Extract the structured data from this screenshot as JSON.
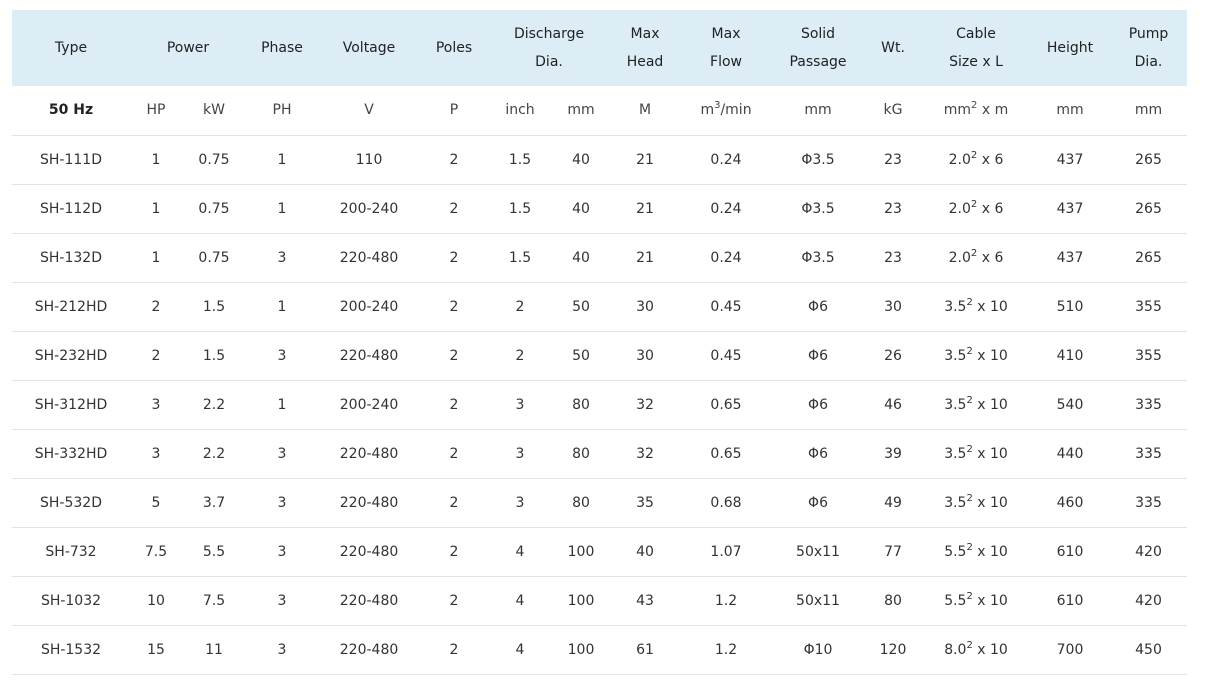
{
  "headers": {
    "type": "Type",
    "power": "Power",
    "phase": "Phase",
    "voltage": "Voltage",
    "poles": "Poles",
    "discharge": [
      "Discharge",
      "Dia."
    ],
    "max_head": [
      "Max",
      "Head"
    ],
    "max_flow": [
      "Max",
      "Flow"
    ],
    "solid_passage": [
      "Solid",
      "Passage"
    ],
    "weight": "Wt.",
    "cable": [
      "Cable",
      "Size x L"
    ],
    "height": "Height",
    "pump_dia": [
      "Pump",
      "Dia."
    ]
  },
  "units": {
    "freq": "50 Hz",
    "hp": "HP",
    "kw": "kW",
    "phase": "PH",
    "voltage": "V",
    "poles": "P",
    "inch": "inch",
    "mm": "mm",
    "head": "M",
    "flow_base": "m",
    "flow_sup": "3",
    "flow_rest": "/min",
    "solid": "mm",
    "weight": "kG",
    "cable_base": "mm",
    "cable_sup": "2",
    "cable_rest": " x m",
    "height": "mm",
    "pump_dia": "mm"
  },
  "rows": [
    {
      "type": "SH-111D",
      "hp": "1",
      "kw": "0.75",
      "phase": "1",
      "voltage": "110",
      "poles": "2",
      "inch": "1.5",
      "mm": "40",
      "head": "21",
      "flow": "0.24",
      "solid": "Φ3.5",
      "weight": "23",
      "cable_base": "2.0",
      "cable_sup": "2",
      "cable_rest": " x 6",
      "height": "437",
      "pump_dia": "265"
    },
    {
      "type": "SH-112D",
      "hp": "1",
      "kw": "0.75",
      "phase": "1",
      "voltage": "200-240",
      "poles": "2",
      "inch": "1.5",
      "mm": "40",
      "head": "21",
      "flow": "0.24",
      "solid": "Φ3.5",
      "weight": "23",
      "cable_base": "2.0",
      "cable_sup": "2",
      "cable_rest": " x 6",
      "height": "437",
      "pump_dia": "265"
    },
    {
      "type": "SH-132D",
      "hp": "1",
      "kw": "0.75",
      "phase": "3",
      "voltage": "220-480",
      "poles": "2",
      "inch": "1.5",
      "mm": "40",
      "head": "21",
      "flow": "0.24",
      "solid": "Φ3.5",
      "weight": "23",
      "cable_base": "2.0",
      "cable_sup": "2",
      "cable_rest": " x 6",
      "height": "437",
      "pump_dia": "265"
    },
    {
      "type": "SH-212HD",
      "hp": "2",
      "kw": "1.5",
      "phase": "1",
      "voltage": "200-240",
      "poles": "2",
      "inch": "2",
      "mm": "50",
      "head": "30",
      "flow": "0.45",
      "solid": "Φ6",
      "weight": "30",
      "cable_base": "3.5",
      "cable_sup": "2",
      "cable_rest": " x 10",
      "height": "510",
      "pump_dia": "355"
    },
    {
      "type": "SH-232HD",
      "hp": "2",
      "kw": "1.5",
      "phase": "3",
      "voltage": "220-480",
      "poles": "2",
      "inch": "2",
      "mm": "50",
      "head": "30",
      "flow": "0.45",
      "solid": "Φ6",
      "weight": "26",
      "cable_base": "3.5",
      "cable_sup": "2",
      "cable_rest": " x 10",
      "height": "410",
      "pump_dia": "355"
    },
    {
      "type": "SH-312HD",
      "hp": "3",
      "kw": "2.2",
      "phase": "1",
      "voltage": "200-240",
      "poles": "2",
      "inch": "3",
      "mm": "80",
      "head": "32",
      "flow": "0.65",
      "solid": "Φ6",
      "weight": "46",
      "cable_base": "3.5",
      "cable_sup": "2",
      "cable_rest": " x 10",
      "height": "540",
      "pump_dia": "335"
    },
    {
      "type": "SH-332HD",
      "hp": "3",
      "kw": "2.2",
      "phase": "3",
      "voltage": "220-480",
      "poles": "2",
      "inch": "3",
      "mm": "80",
      "head": "32",
      "flow": "0.65",
      "solid": "Φ6",
      "weight": "39",
      "cable_base": "3.5",
      "cable_sup": "2",
      "cable_rest": " x 10",
      "height": "440",
      "pump_dia": "335"
    },
    {
      "type": "SH-532D",
      "hp": "5",
      "kw": "3.7",
      "phase": "3",
      "voltage": "220-480",
      "poles": "2",
      "inch": "3",
      "mm": "80",
      "head": "35",
      "flow": "0.68",
      "solid": "Φ6",
      "weight": "49",
      "cable_base": "3.5",
      "cable_sup": "2",
      "cable_rest": " x 10",
      "height": "460",
      "pump_dia": "335"
    },
    {
      "type": "SH-732",
      "hp": "7.5",
      "kw": "5.5",
      "phase": "3",
      "voltage": "220-480",
      "poles": "2",
      "inch": "4",
      "mm": "100",
      "head": "40",
      "flow": "1.07",
      "solid": "50x11",
      "weight": "77",
      "cable_base": "5.5",
      "cable_sup": "2",
      "cable_rest": " x 10",
      "height": "610",
      "pump_dia": "420"
    },
    {
      "type": "SH-1032",
      "hp": "10",
      "kw": "7.5",
      "phase": "3",
      "voltage": "220-480",
      "poles": "2",
      "inch": "4",
      "mm": "100",
      "head": "43",
      "flow": "1.2",
      "solid": "50x11",
      "weight": "80",
      "cable_base": "5.5",
      "cable_sup": "2",
      "cable_rest": " x 10",
      "height": "610",
      "pump_dia": "420"
    },
    {
      "type": "SH-1532",
      "hp": "15",
      "kw": "11",
      "phase": "3",
      "voltage": "220-480",
      "poles": "2",
      "inch": "4",
      "mm": "100",
      "head": "61",
      "flow": "1.2",
      "solid": "Φ10",
      "weight": "120",
      "cable_base": "8.0",
      "cable_sup": "2",
      "cable_rest": " x 10",
      "height": "700",
      "pump_dia": "450"
    }
  ],
  "colors": {
    "header_bg": "#dcedf6",
    "row_border": "#e2e2e2",
    "text": "#333333"
  }
}
